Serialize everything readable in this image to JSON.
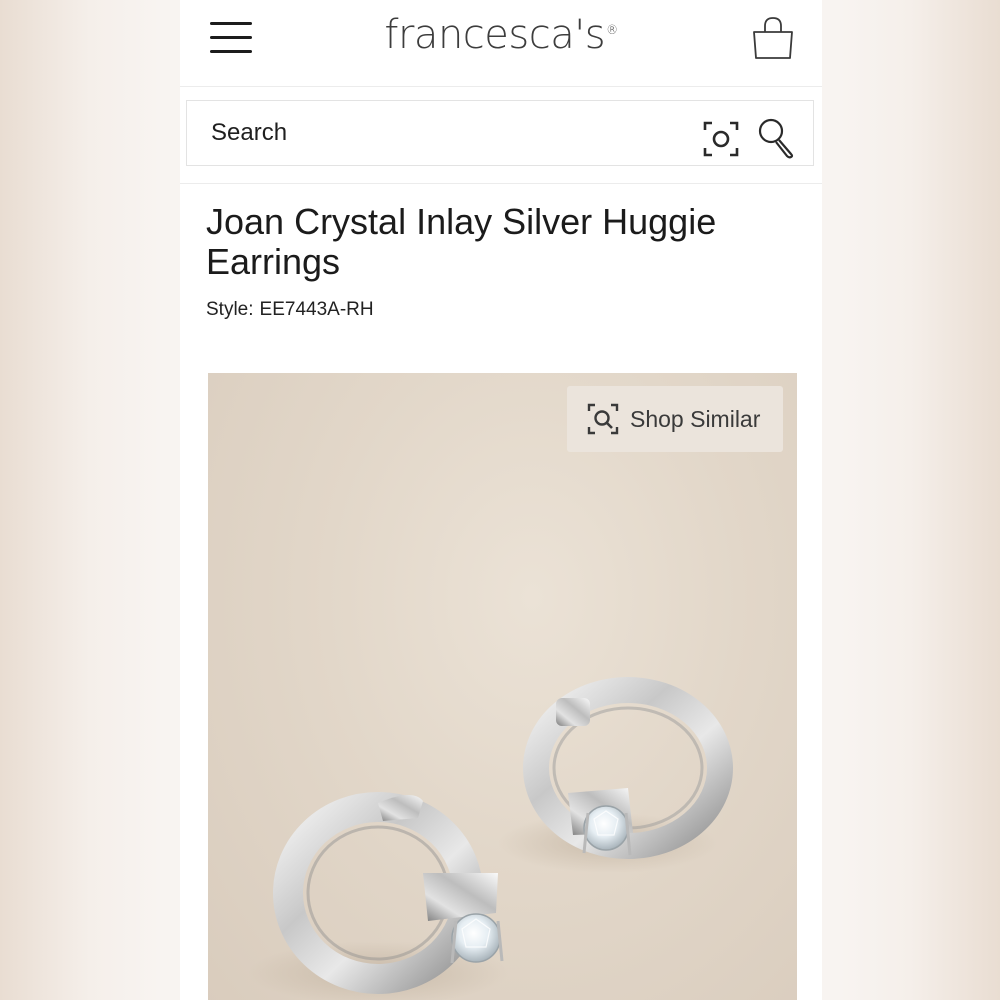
{
  "header": {
    "logo_text": "francesca's",
    "menu_icon": "hamburger-menu-icon",
    "bag_icon": "shopping-bag-icon"
  },
  "search": {
    "placeholder": "Search",
    "visual_search_icon": "camera-scan-icon",
    "search_icon": "magnifier-icon"
  },
  "product": {
    "title": "Joan Crystal Inlay Silver Huggie Earrings",
    "style_label": "Style:",
    "style_value": "EE7443A-RH"
  },
  "image": {
    "shop_similar_label": "Shop Similar",
    "shop_similar_icon": "visual-search-icon"
  },
  "colors": {
    "text_primary": "#1b1b1b",
    "logo": "#3d3d3d",
    "border": "#e3e3e3",
    "image_background": "#e2d7c9"
  }
}
